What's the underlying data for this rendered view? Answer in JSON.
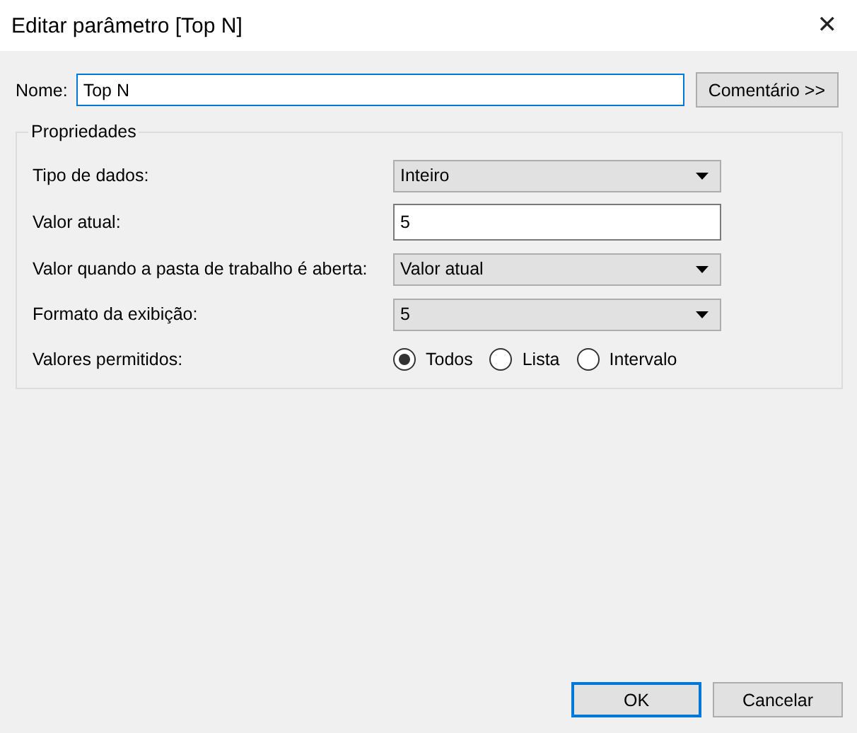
{
  "window": {
    "title": "Editar parâmetro [Top N]",
    "close": "✕"
  },
  "name": {
    "label": "Nome:",
    "value": "Top N",
    "focused": true
  },
  "comment_button": "Comentário >>",
  "properties": {
    "title": "Propriedades",
    "rows": [
      {
        "kind": "dropdown",
        "label": "Tipo de dados:",
        "value": "Inteiro"
      },
      {
        "kind": "input",
        "label": "Valor atual:",
        "value": "5"
      },
      {
        "kind": "dropdown",
        "label": "Valor quando a pasta de trabalho é aberta:",
        "value": "Valor atual"
      },
      {
        "kind": "dropdown",
        "label": "Formato da exibição:",
        "value": "5"
      },
      {
        "kind": "radio",
        "label": "Valores permitidos:",
        "options": [
          {
            "label": "Todos",
            "selected": true
          },
          {
            "label": "Lista",
            "selected": false
          },
          {
            "label": "Intervalo",
            "selected": false
          }
        ]
      }
    ]
  },
  "buttons": [
    {
      "label": "OK",
      "default": true
    },
    {
      "label": "Cancelar",
      "default": false
    }
  ]
}
